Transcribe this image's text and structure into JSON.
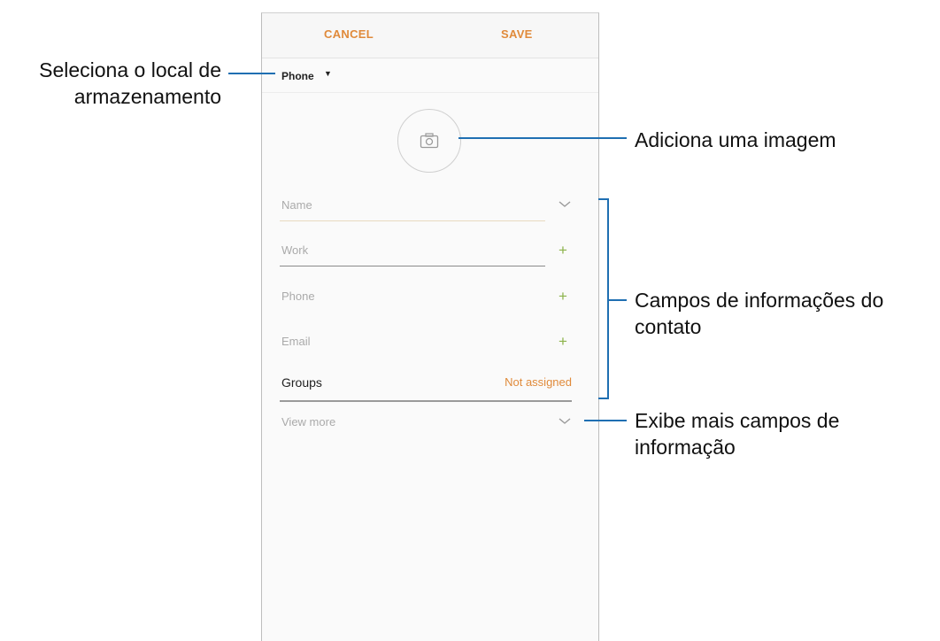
{
  "topbar": {
    "cancel_label": "CANCEL",
    "save_label": "SAVE"
  },
  "storage": {
    "label": "Phone",
    "caret_icon": "triangle-down-icon"
  },
  "photo": {
    "icon": "camera-icon"
  },
  "fields": {
    "name": {
      "placeholder": "Name",
      "icon": "chevron-down-icon"
    },
    "work": {
      "placeholder": "Work",
      "icon": "plus-icon"
    },
    "phone": {
      "placeholder": "Phone",
      "icon": "plus-icon"
    },
    "email": {
      "placeholder": "Email",
      "icon": "plus-icon"
    }
  },
  "groups": {
    "label": "Groups",
    "value": "Not assigned"
  },
  "view_more": {
    "label": "View more",
    "icon": "chevron-down-icon"
  },
  "annotations": {
    "storage_line1": "Seleciona o local de",
    "storage_line2": "armazenamento",
    "image": "Adiciona uma imagem",
    "fields_line1": "Campos de informações do",
    "fields_line2": "contato",
    "more_line1": "Exibe mais campos de",
    "more_line2": "informação"
  },
  "colors": {
    "accent": "#e08a3a",
    "plus": "#8cb34a",
    "callout": "#1f6fb2"
  }
}
